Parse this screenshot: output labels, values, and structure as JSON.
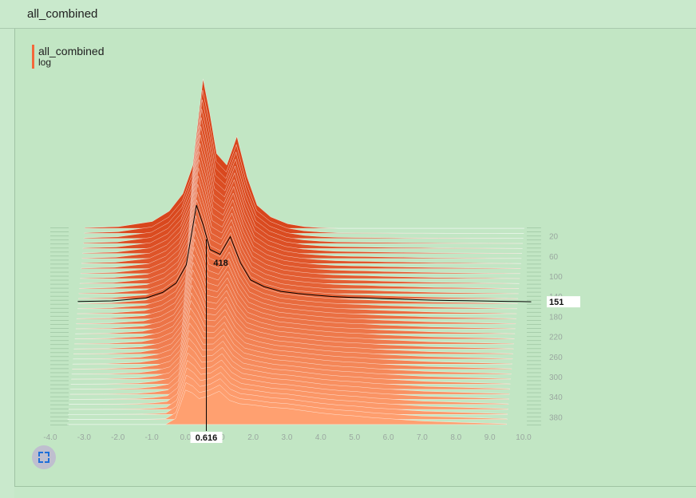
{
  "header": {
    "title": "all_combined"
  },
  "legend": {
    "run_name": "all_combined",
    "mode": "log",
    "color": "#f4683b"
  },
  "chart_data": {
    "type": "area",
    "subtype": "histogram-offset",
    "tag": "all_combined",
    "x_ticks": [
      -4.0,
      -3.0,
      -2.0,
      -1.0,
      0.0,
      1.0,
      2.0,
      3.0,
      4.0,
      5.0,
      6.0,
      7.0,
      8.0,
      9.0,
      10.0
    ],
    "x_range": [
      -4.0,
      10.0
    ],
    "step_ticks": [
      20,
      60,
      100,
      140,
      180,
      220,
      260,
      300,
      340,
      380
    ],
    "step_range": [
      0,
      400
    ],
    "hover": {
      "step": 151,
      "x": 0.616,
      "value": 418
    },
    "colors": {
      "oldest": "#d8461c",
      "newest": "#ffa070",
      "outline": "#ffffff"
    },
    "series_profile": {
      "x": [
        -3.5,
        -2.5,
        -1.5,
        -1.0,
        -0.6,
        -0.3,
        0.0,
        0.2,
        0.4,
        0.7,
        1.0,
        1.3,
        1.6,
        2.0,
        2.5,
        3.0,
        3.5,
        4.0,
        4.5,
        5.0,
        5.5,
        6.0,
        6.5,
        7.0,
        7.5,
        8.0,
        8.5,
        9.0,
        9.5
      ],
      "early_density": [
        1,
        3,
        12,
        30,
        60,
        110,
        260,
        200,
        130,
        110,
        160,
        90,
        40,
        20,
        8,
        3,
        1,
        0,
        0,
        0,
        0,
        0,
        0,
        0,
        0,
        0,
        0,
        0,
        0
      ],
      "late_density": [
        0,
        0,
        0,
        0,
        0,
        10,
        60,
        55,
        45,
        50,
        58,
        42,
        36,
        34,
        30,
        28,
        24,
        20,
        17,
        15,
        12,
        10,
        8,
        6,
        5,
        4,
        3,
        2,
        1
      ]
    }
  }
}
